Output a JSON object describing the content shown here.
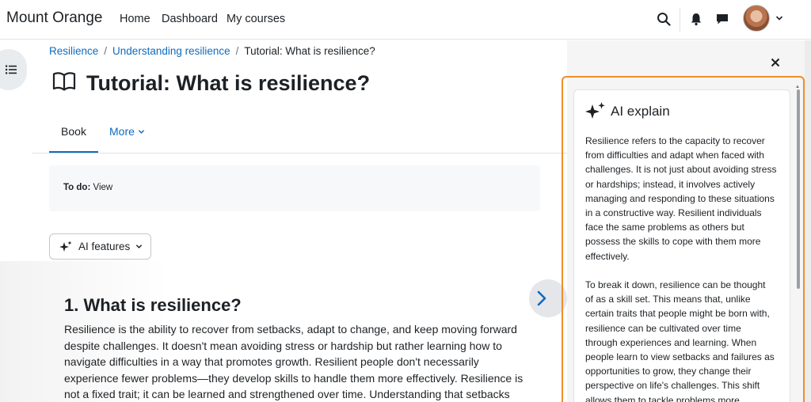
{
  "navbar": {
    "brand": "Mount Orange",
    "links": [
      "Home",
      "Dashboard",
      "My courses"
    ],
    "icons": [
      "search-icon",
      "bell-icon",
      "chat-icon"
    ],
    "avatar": "user-avatar"
  },
  "breadcrumb": {
    "items": [
      "Resilience",
      "Understanding resilience",
      "Tutorial: What is resilience?"
    ]
  },
  "page": {
    "title": "Tutorial: What is resilience?",
    "title_icon": "book-icon"
  },
  "tabs": {
    "book": "Book",
    "more": "More"
  },
  "todo": {
    "label": "To do:",
    "value": "View"
  },
  "ai_features": {
    "label": "AI features"
  },
  "content": {
    "heading": "1. What is resilience?",
    "lines": [
      "Resilience is the ability to recover from setbacks, adapt to change, and keep moving forward",
      "despite challenges. It doesn't mean avoiding stress or hardship but rather learning how to",
      "navigate difficulties in a way that promotes growth. Resilient people don't necessarily",
      "experience fewer problems—they develop skills to handle them more effectively. Resilience is",
      "not a fixed trait; it can be learned and strengthened over time. Understanding that setbacks"
    ]
  },
  "ai_explain": {
    "title": "AI explain",
    "paragraph1": [
      "Resilience refers to the capacity to recover",
      "from difficulties and adapt when faced with",
      "challenges. It is not just about avoiding stress",
      "or hardships; instead, it involves actively",
      "managing and responding to these situations",
      "in a constructive way. Resilient individuals",
      "face the same problems as others but",
      "possess the skills to cope with them more",
      "effectively."
    ],
    "paragraph2": [
      "To break it down, resilience can be thought",
      "of as a skill set. This means that, unlike",
      "certain traits that people might be born with,",
      "resilience can be cultivated over time",
      "through experiences and learning. When",
      "people learn to view setbacks and failures as",
      "opportunities to grow, they change their",
      "perspective on life's challenges. This shift",
      "allows them to tackle problems more"
    ]
  },
  "colors": {
    "link": "#0f6cbf",
    "highlight": "#f28c2a",
    "text": "#1d2125"
  }
}
